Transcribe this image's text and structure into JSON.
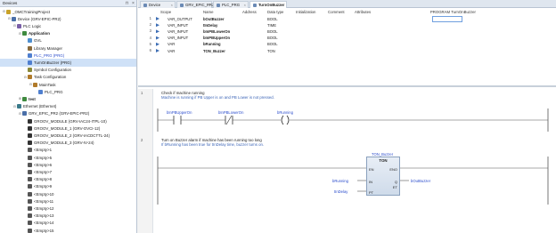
{
  "devices": {
    "title": "Devices",
    "tree": [
      {
        "label": "_OMCTrainingProject",
        "level": 0,
        "toggle": "⊟",
        "icon": "project"
      },
      {
        "label": "Device (GRV-EPIC-PR2)",
        "level": 1,
        "toggle": "⊟",
        "icon": "device"
      },
      {
        "label": "PLC Logic",
        "level": 2,
        "toggle": "⊟",
        "icon": "plc"
      },
      {
        "label": "Application",
        "level": 3,
        "toggle": "⊟",
        "icon": "app",
        "bold": true
      },
      {
        "label": "GVL",
        "level": 4,
        "toggle": "",
        "icon": "gvl"
      },
      {
        "label": "Library Manager",
        "level": 4,
        "toggle": "",
        "icon": "lib"
      },
      {
        "label": "PLC_PRG (PRG)",
        "level": 4,
        "toggle": "",
        "icon": "pou",
        "link": true
      },
      {
        "label": "TurnOnBuzzer (PRG)",
        "level": 4,
        "toggle": "",
        "icon": "pou",
        "selected": true
      },
      {
        "label": "Symbol Configuration",
        "level": 4,
        "toggle": "",
        "icon": "sym"
      },
      {
        "label": "Task Configuration",
        "level": 4,
        "toggle": "⊟",
        "icon": "task"
      },
      {
        "label": "MainTask",
        "level": 5,
        "toggle": "⊟",
        "icon": "task"
      },
      {
        "label": "PLC_PRG",
        "level": 6,
        "toggle": "",
        "icon": "pou"
      },
      {
        "label": "test",
        "level": 3,
        "toggle": "⊞",
        "icon": "app",
        "bold": true
      },
      {
        "label": "Ethernet (Ethernet)",
        "level": 2,
        "toggle": "⊟",
        "icon": "eth"
      },
      {
        "label": "GRV_EPIC_PR2 (GRV-EPIC-PR2)",
        "level": 3,
        "toggle": "⊟",
        "icon": "device"
      },
      {
        "label": "GROOV_MODULE (GRV-IAC24-ITPL-10)",
        "level": 4,
        "toggle": "",
        "icon": "module"
      },
      {
        "label": "GROOV_MODULE_1 (GRV-OVCI-12)",
        "level": 4,
        "toggle": "",
        "icon": "module"
      },
      {
        "label": "GROOV_MODULE_2 (GRV-IACDCTTL-24)",
        "level": 4,
        "toggle": "",
        "icon": "module"
      },
      {
        "label": "GROOV_MODULE_3 (GRV-IV-24)",
        "level": 4,
        "toggle": "",
        "icon": "module"
      },
      {
        "label": "<Empty>1",
        "level": 4,
        "toggle": "",
        "icon": "empty"
      },
      {
        "label": "<Empty>5",
        "level": 4,
        "toggle": "",
        "icon": "empty"
      },
      {
        "label": "<Empty>6",
        "level": 4,
        "toggle": "",
        "icon": "empty"
      },
      {
        "label": "<Empty>7",
        "level": 4,
        "toggle": "",
        "icon": "empty"
      },
      {
        "label": "<Empty>8",
        "level": 4,
        "toggle": "",
        "icon": "empty"
      },
      {
        "label": "<Empty>9",
        "level": 4,
        "toggle": "",
        "icon": "empty"
      },
      {
        "label": "<Empty>10",
        "level": 4,
        "toggle": "",
        "icon": "empty"
      },
      {
        "label": "<Empty>11",
        "level": 4,
        "toggle": "",
        "icon": "empty"
      },
      {
        "label": "<Empty>12",
        "level": 4,
        "toggle": "",
        "icon": "empty"
      },
      {
        "label": "<Empty>13",
        "level": 4,
        "toggle": "",
        "icon": "empty"
      },
      {
        "label": "<Empty>14",
        "level": 4,
        "toggle": "",
        "icon": "empty"
      },
      {
        "label": "<Empty>15",
        "level": 4,
        "toggle": "",
        "icon": "empty"
      }
    ]
  },
  "tabs": [
    {
      "label": "Device",
      "active": false
    },
    {
      "label": "GRV_EPIC_PR2",
      "active": false
    },
    {
      "label": "PLC_PRG",
      "active": false
    },
    {
      "label": "TurnOnBuzzer",
      "active": true
    }
  ],
  "declaration": {
    "program_title": "PROGRAM TurnOnBuzzer",
    "columns": {
      "scope": "Scope",
      "name": "Name",
      "address": "Address",
      "datatype": "Data type",
      "initialization": "Initialization",
      "comment": "Comment",
      "attributes": "Attributes"
    },
    "rows": [
      {
        "num": "1",
        "scope": "VAR_OUTPUT",
        "name": "bOutBuzzer",
        "address": "",
        "datatype": "BOOL"
      },
      {
        "num": "2",
        "scope": "VAR_INPUT",
        "name": "tInDelay",
        "address": "",
        "datatype": "TIME"
      },
      {
        "num": "3",
        "scope": "VAR_INPUT",
        "name": "bInPBLowerOn",
        "address": "",
        "datatype": "BOOL"
      },
      {
        "num": "4",
        "scope": "VAR_INPUT",
        "name": "bInPBUpperOn",
        "address": "",
        "datatype": "BOOL"
      },
      {
        "num": "5",
        "scope": "VAR",
        "name": "bRunning",
        "address": "",
        "datatype": "BOOL"
      },
      {
        "num": "6",
        "scope": "VAR",
        "name": "TON_Buzzer",
        "address": "",
        "datatype": "TON"
      }
    ]
  },
  "ladder": {
    "rungs": [
      {
        "num": "1",
        "comment": "Check if machine running",
        "subcomment": "Machine is running if PB Upper is on and PB Lower is not pressed.",
        "contacts": [
          {
            "label": "bInPBUpperOn",
            "type": "NO"
          },
          {
            "label": "bInPBLowerOn",
            "type": "NC"
          }
        ],
        "coil": {
          "label": "bRunning"
        }
      },
      {
        "num": "2",
        "comment": "Turn on Buzzer alarm if machine has been running too long",
        "subcomment": "If bRunning has been true for tInDelay time, buzzer turns on.",
        "block": {
          "instance": "TON_Buzzer",
          "type": "TON",
          "inputs": [
            "EN",
            "IN",
            "PT"
          ],
          "outputs": [
            "ENO",
            "Q",
            "ET"
          ]
        },
        "in_labels": {
          "in": "bRunning",
          "pt": "tInDelay"
        },
        "out_label": "bOutBuzzer"
      }
    ]
  },
  "colors": {
    "accent": "#2a4ccc",
    "selection": "#cfe1f7",
    "panel_header": "#e4ebf5"
  }
}
